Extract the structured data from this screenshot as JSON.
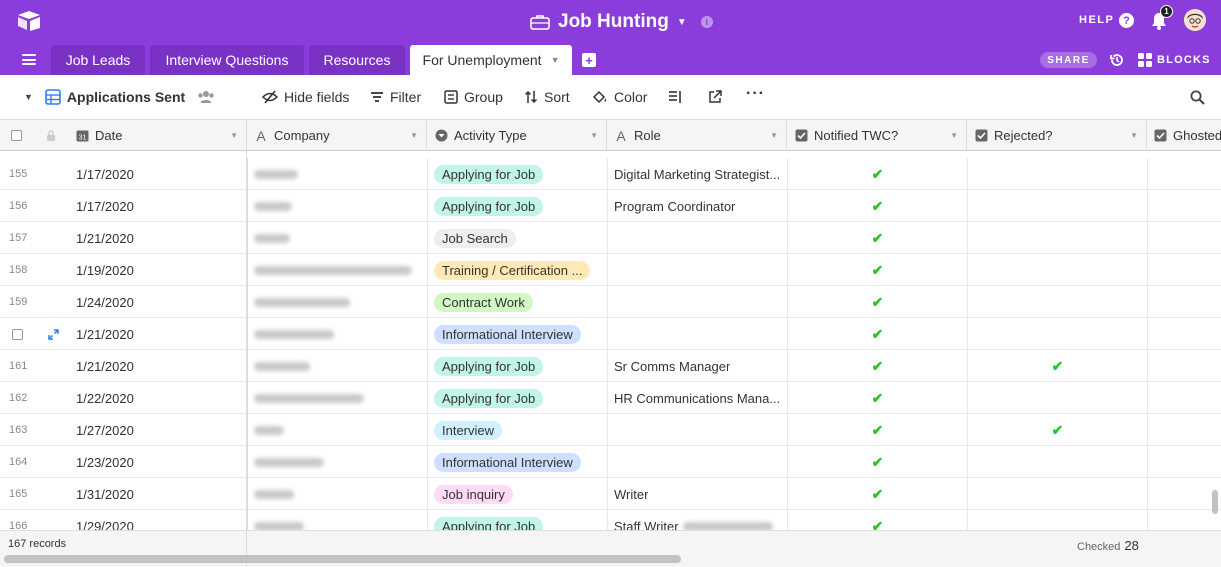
{
  "header": {
    "title": "Job Hunting",
    "help_label": "HELP",
    "notification_count": "1",
    "brand_color": "#8b3ddb"
  },
  "tabs": [
    {
      "label": "Job Leads",
      "active": false
    },
    {
      "label": "Interview Questions",
      "active": false
    },
    {
      "label": "Resources",
      "active": false
    },
    {
      "label": "For Unemployment",
      "active": true
    }
  ],
  "tabbar": {
    "share_label": "SHARE",
    "blocks_label": "BLOCKS"
  },
  "toolbar": {
    "view_name": "Applications Sent",
    "hide_fields": "Hide fields",
    "filter": "Filter",
    "group": "Group",
    "sort": "Sort",
    "color": "Color"
  },
  "columns": [
    {
      "label": "Date",
      "icon": "calendar-icon"
    },
    {
      "label": "Company",
      "icon": "text-icon"
    },
    {
      "label": "Activity Type",
      "icon": "select-icon"
    },
    {
      "label": "Role",
      "icon": "text-icon"
    },
    {
      "label": "Notified TWC?",
      "icon": "checkbox-icon"
    },
    {
      "label": "Rejected?",
      "icon": "checkbox-icon"
    },
    {
      "label": "Ghosted",
      "icon": "checkbox-icon"
    }
  ],
  "rows": [
    {
      "num": "155",
      "date": "1/17/2020",
      "activity": "Applying for Job",
      "activity_color": "#c2f5e9",
      "role": "Digital Marketing Strategist...",
      "twc": "✔",
      "rejected": ""
    },
    {
      "num": "156",
      "date": "1/17/2020",
      "activity": "Applying for Job",
      "activity_color": "#c2f5e9",
      "role": "Program Coordinator",
      "twc": "✔",
      "rejected": ""
    },
    {
      "num": "157",
      "date": "1/21/2020",
      "activity": "Job Search",
      "activity_color": "#eeeeee",
      "role": "",
      "twc": "✔",
      "rejected": ""
    },
    {
      "num": "158",
      "date": "1/19/2020",
      "activity": "Training / Certification ...",
      "activity_color": "#ffeab6",
      "role": "",
      "twc": "✔",
      "rejected": ""
    },
    {
      "num": "159",
      "date": "1/24/2020",
      "activity": "Contract Work",
      "activity_color": "#d1f7c4",
      "role": "",
      "twc": "✔",
      "rejected": ""
    },
    {
      "num": "",
      "date": "1/21/2020",
      "activity": "Informational Interview",
      "activity_color": "#cfdfff",
      "role": "",
      "twc": "✔",
      "rejected": ""
    },
    {
      "num": "161",
      "date": "1/21/2020",
      "activity": "Applying for Job",
      "activity_color": "#c2f5e9",
      "role": "Sr Comms Manager",
      "twc": "✔",
      "rejected": "✔"
    },
    {
      "num": "162",
      "date": "1/22/2020",
      "activity": "Applying for Job",
      "activity_color": "#c2f5e9",
      "role": "HR Communications Mana...",
      "twc": "✔",
      "rejected": ""
    },
    {
      "num": "163",
      "date": "1/27/2020",
      "activity": "Interview",
      "activity_color": "#d0f0fd",
      "role": "",
      "twc": "✔",
      "rejected": "✔"
    },
    {
      "num": "164",
      "date": "1/23/2020",
      "activity": "Informational Interview",
      "activity_color": "#cfdfff",
      "role": "",
      "twc": "✔",
      "rejected": ""
    },
    {
      "num": "165",
      "date": "1/31/2020",
      "activity": "Job inquiry",
      "activity_color": "#ffdaf6",
      "role": "Writer",
      "twc": "✔",
      "rejected": ""
    },
    {
      "num": "166",
      "date": "1/29/2020",
      "activity": "Applying for Job",
      "activity_color": "#c2f5e9",
      "role": "Staff Writer",
      "twc": "✔",
      "rejected": ""
    }
  ],
  "footer": {
    "records": "167 records",
    "checked_label": "Checked",
    "checked_count": "28"
  }
}
